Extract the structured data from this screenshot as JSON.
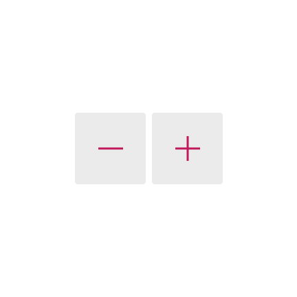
{
  "zoom_control": {
    "accent_color": "#c2185b",
    "button_background": "#ebebeb",
    "buttons": [
      {
        "action": "zoom-out",
        "icon": "minus-icon"
      },
      {
        "action": "zoom-in",
        "icon": "plus-icon"
      }
    ]
  }
}
